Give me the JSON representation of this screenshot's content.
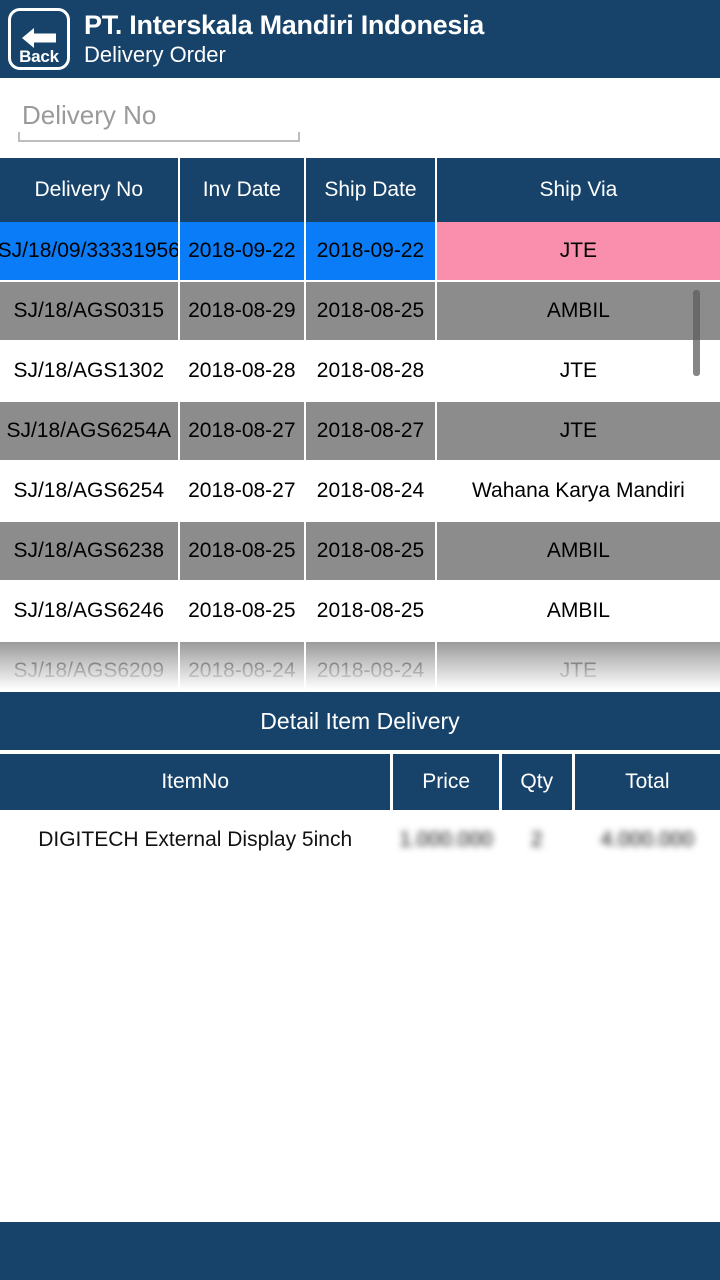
{
  "appbar": {
    "back_label": "Back",
    "back_icon": "arrow-left-icon",
    "title": "PT. Interskala Mandiri Indonesia",
    "subtitle": "Delivery Order"
  },
  "search": {
    "value": "",
    "placeholder": "Delivery No",
    "search_icon": "search-icon",
    "camera_icon": "camera-icon"
  },
  "master_table": {
    "columns": [
      "Delivery No",
      "Inv Date",
      "Ship Date",
      "Ship Via"
    ],
    "rows": [
      {
        "delivery_no": "SJ/18/09/33331956",
        "inv_date": "2018-09-22",
        "ship_date": "2018-09-22",
        "ship_via": "JTE",
        "style": "selected"
      },
      {
        "delivery_no": "SJ/18/AGS0315",
        "inv_date": "2018-08-29",
        "ship_date": "2018-08-25",
        "ship_via": "AMBIL",
        "style": "shaded"
      },
      {
        "delivery_no": "SJ/18/AGS1302",
        "inv_date": "2018-08-28",
        "ship_date": "2018-08-28",
        "ship_via": "JTE",
        "style": "plain"
      },
      {
        "delivery_no": "SJ/18/AGS6254A",
        "inv_date": "2018-08-27",
        "ship_date": "2018-08-27",
        "ship_via": "JTE",
        "style": "shaded"
      },
      {
        "delivery_no": "SJ/18/AGS6254",
        "inv_date": "2018-08-27",
        "ship_date": "2018-08-24",
        "ship_via": "Wahana Karya Mandiri",
        "style": "plain"
      },
      {
        "delivery_no": "SJ/18/AGS6238",
        "inv_date": "2018-08-25",
        "ship_date": "2018-08-25",
        "ship_via": "AMBIL",
        "style": "shaded"
      },
      {
        "delivery_no": "SJ/18/AGS6246",
        "inv_date": "2018-08-25",
        "ship_date": "2018-08-25",
        "ship_via": "AMBIL",
        "style": "plain"
      },
      {
        "delivery_no": "SJ/18/AGS6209",
        "inv_date": "2018-08-24",
        "ship_date": "2018-08-24",
        "ship_via": "JTE",
        "style": "shaded"
      }
    ]
  },
  "detail": {
    "banner": "Detail Item Delivery",
    "columns": [
      "ItemNo",
      "Price",
      "Qty",
      "Total"
    ],
    "rows": [
      {
        "item_no": "DIGITECH  External Display 5inch",
        "price": "1.000.000",
        "qty": "2",
        "total": "4.000.000"
      }
    ]
  },
  "colors": {
    "navy": "#17436a",
    "selected_blue": "#0a7cf7",
    "selected_pink": "#f98fad",
    "row_gray": "#8c8c8c"
  }
}
